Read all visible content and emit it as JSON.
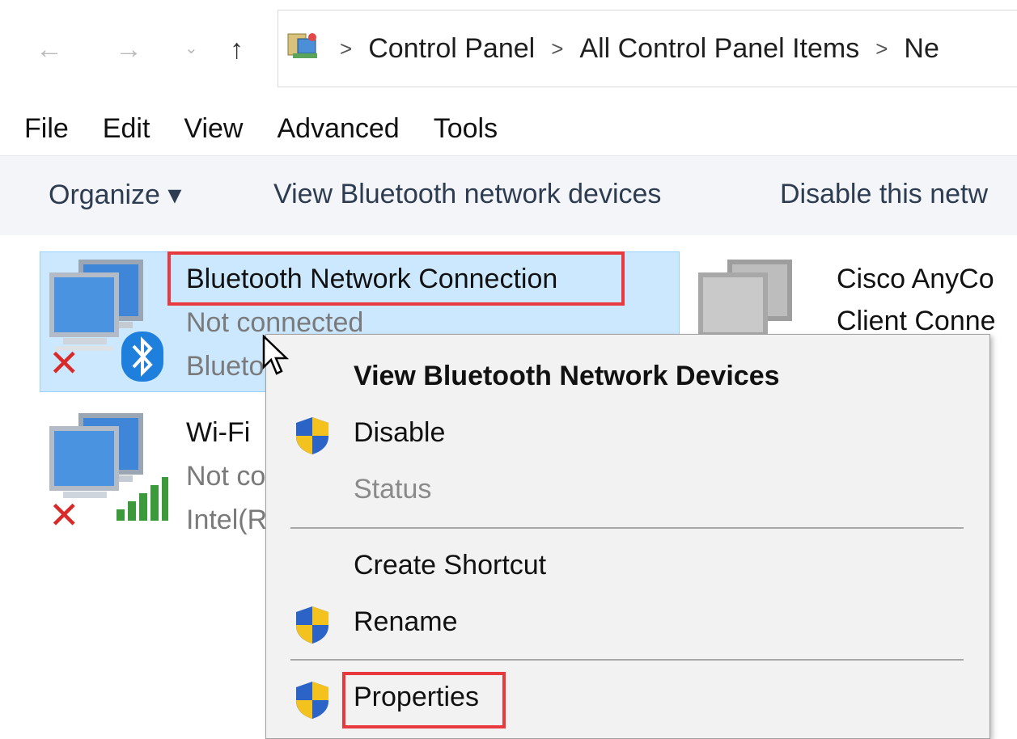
{
  "addressbar": {
    "back_icon": "back-arrow-icon",
    "forward_icon": "forward-arrow-icon",
    "recent_icon": "chevron-down-icon",
    "up_icon": "up-arrow-icon",
    "breadcrumbs": [
      "Control Panel",
      "All Control Panel Items",
      "Ne"
    ]
  },
  "menubar": {
    "items": [
      "File",
      "Edit",
      "View",
      "Advanced",
      "Tools"
    ]
  },
  "commandbar": {
    "organize": "Organize ▾",
    "view_bt_devices": "View Bluetooth network devices",
    "disable": "Disable this netw"
  },
  "connections": [
    {
      "title": "Bluetooth Network Connection",
      "status": "Not connected",
      "device": "Blueto",
      "selected": true
    },
    {
      "title": "Wi-Fi",
      "status": "Not co",
      "device": "Intel(R",
      "selected": false
    },
    {
      "title": "Cisco AnyCo",
      "title2": "Client Conne",
      "selected": false
    }
  ],
  "context_menu": {
    "items": [
      {
        "label": "View Bluetooth Network Devices",
        "bold": true,
        "shield": false,
        "disabled": false
      },
      {
        "label": "Disable",
        "bold": false,
        "shield": true,
        "disabled": false
      },
      {
        "label": "Status",
        "bold": false,
        "shield": false,
        "disabled": true
      },
      {
        "label": "Create Shortcut",
        "bold": false,
        "shield": false,
        "disabled": false
      },
      {
        "label": "Rename",
        "bold": false,
        "shield": true,
        "disabled": false
      },
      {
        "label": "Properties",
        "bold": false,
        "shield": true,
        "disabled": false
      }
    ]
  },
  "colors": {
    "selection_bg": "#cce8ff",
    "highlight_box": "#e8393f",
    "menu_bg": "#f2f2f2"
  }
}
